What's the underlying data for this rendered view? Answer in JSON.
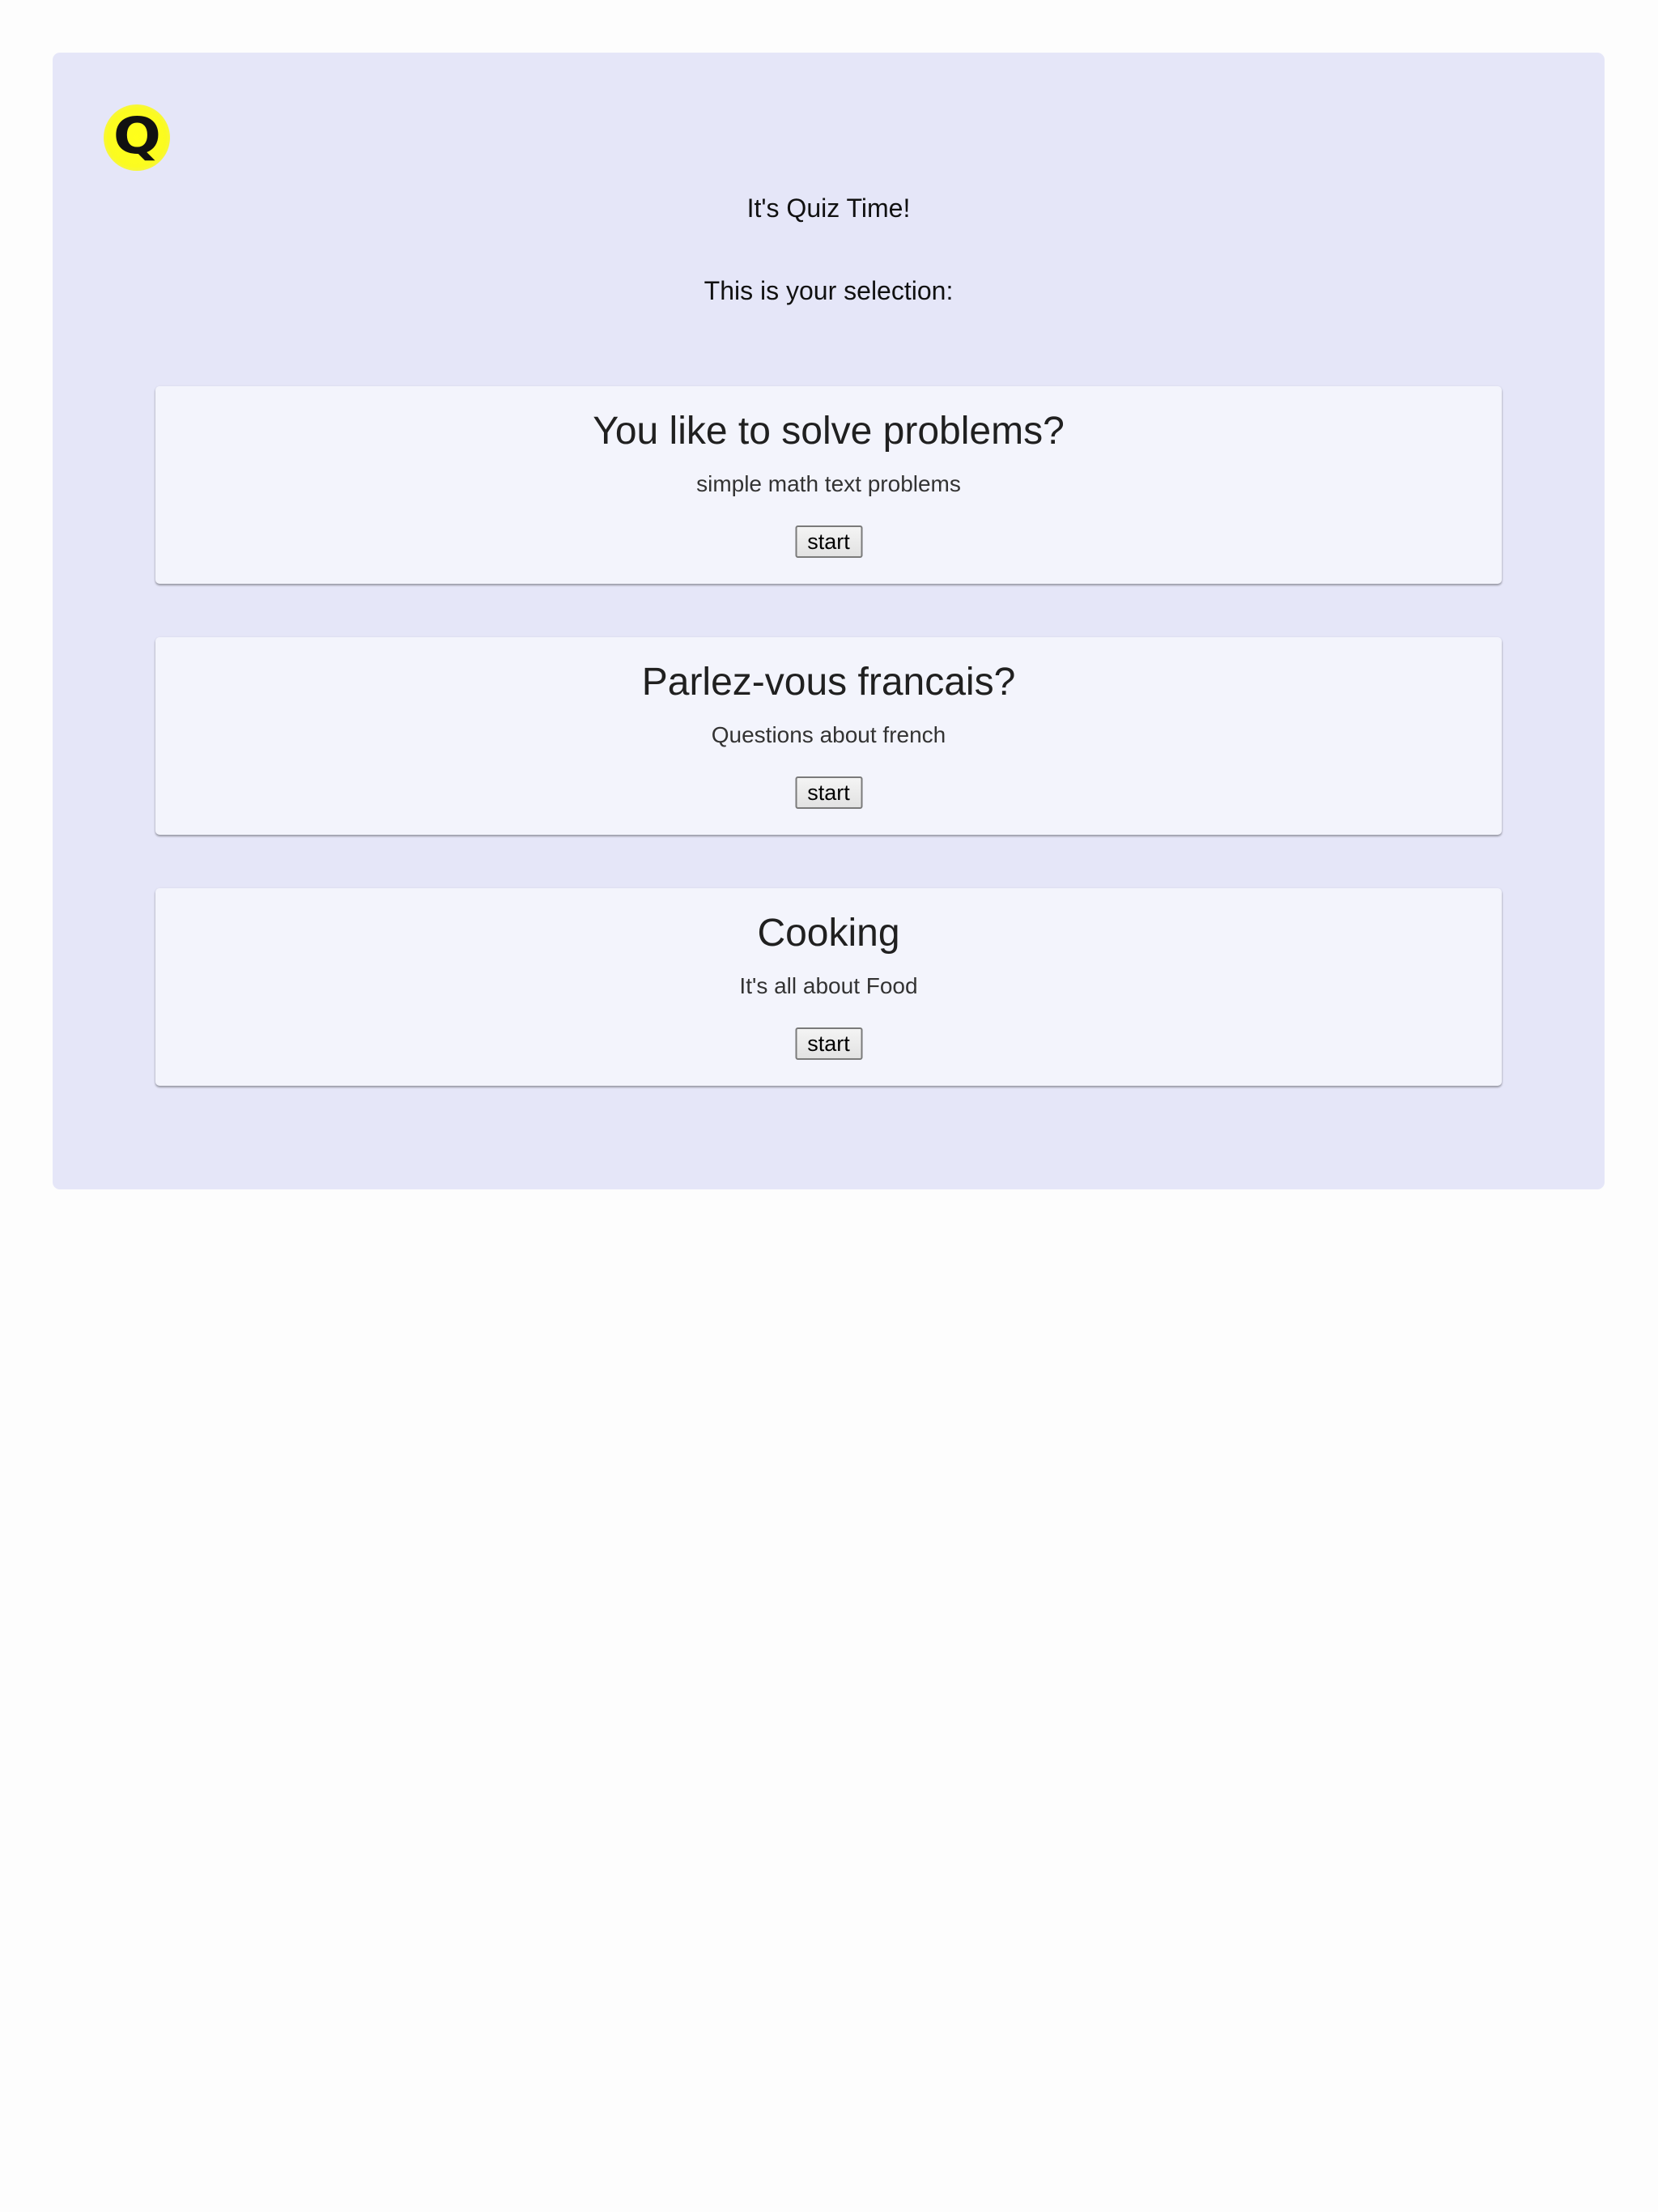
{
  "app": {
    "logo_letter": "Q",
    "title": "It's Quiz Time!",
    "selection_label": "This is your selection:"
  },
  "quizzes": [
    {
      "title": "You like to solve problems?",
      "description": "simple math text problems",
      "button_label": "start"
    },
    {
      "title": "Parlez-vous francais?",
      "description": "Questions about french",
      "button_label": "start"
    },
    {
      "title": "Cooking",
      "description": "It's all about Food",
      "button_label": "start"
    }
  ],
  "colors": {
    "page_background": "#fdfdfd",
    "panel_background": "#e5e6f8",
    "card_background": "#f3f4fc",
    "logo_yellow": "#ffff1a"
  }
}
